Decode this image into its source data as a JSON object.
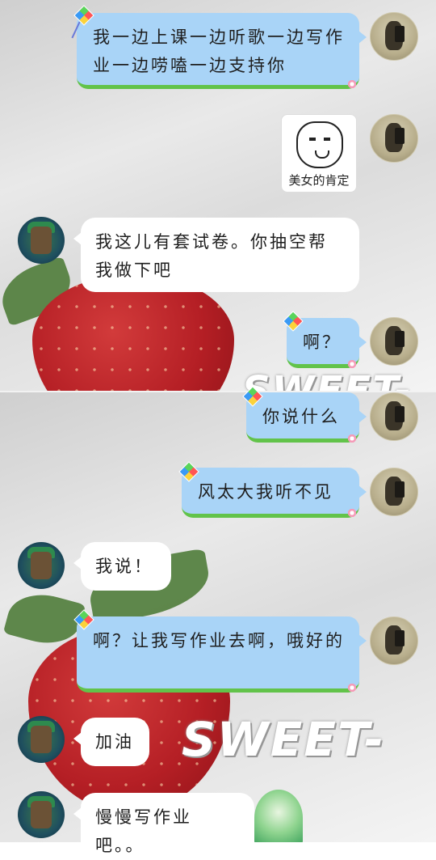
{
  "background": {
    "watermark_text": "SWEET-"
  },
  "messages": [
    {
      "side": "right",
      "text": "我一边上课一边听歌一边写作业一边唠嗑一边支持你"
    },
    {
      "side": "right",
      "type": "sticker",
      "caption": "美女的肯定"
    },
    {
      "side": "left",
      "text": "我这儿有套试卷。你抽空帮我做下吧"
    },
    {
      "side": "right",
      "text": "啊？"
    },
    {
      "side": "right",
      "text": "你说什么"
    },
    {
      "side": "right",
      "text": "风太大我听不见"
    },
    {
      "side": "left",
      "text": "我说！"
    },
    {
      "side": "right",
      "text": "啊？让我写作业去啊，哦好的"
    },
    {
      "side": "left",
      "text": "加油"
    },
    {
      "side": "left",
      "text": "慢慢写作业吧。。"
    }
  ],
  "colors": {
    "right_bubble": "#a9d4f7",
    "right_bubble_trim": "#62c34a",
    "left_bubble": "#ffffff"
  },
  "icons": {
    "bubble_decoration": "kite-icon",
    "my_avatar": "avatar-me",
    "friend_avatar": "avatar-friend"
  }
}
